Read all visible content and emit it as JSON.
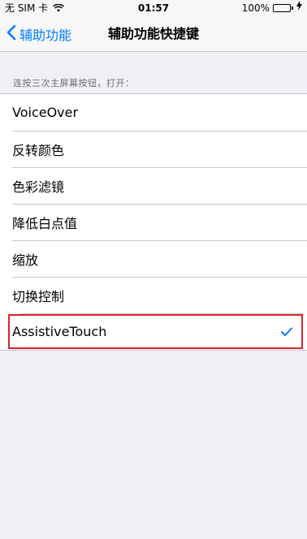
{
  "status_bar": {
    "carrier": "无 SIM 卡",
    "time": "01:57",
    "battery": "100%",
    "battery_level": 1.0,
    "battery_color": "#4cd964"
  },
  "nav": {
    "back_label": "辅助功能",
    "title": "辅助功能快捷键",
    "accent_color": "#007aff"
  },
  "section": {
    "header": "连按三次主屏幕按钮，打开："
  },
  "options": [
    {
      "label": "VoiceOver",
      "selected": false
    },
    {
      "label": "反转颜色",
      "selected": false
    },
    {
      "label": "色彩滤镜",
      "selected": false
    },
    {
      "label": "降低白点值",
      "selected": false
    },
    {
      "label": "缩放",
      "selected": false
    },
    {
      "label": "切换控制",
      "selected": false
    },
    {
      "label": "AssistiveTouch",
      "selected": true
    }
  ],
  "highlight_color": "#d9232a"
}
